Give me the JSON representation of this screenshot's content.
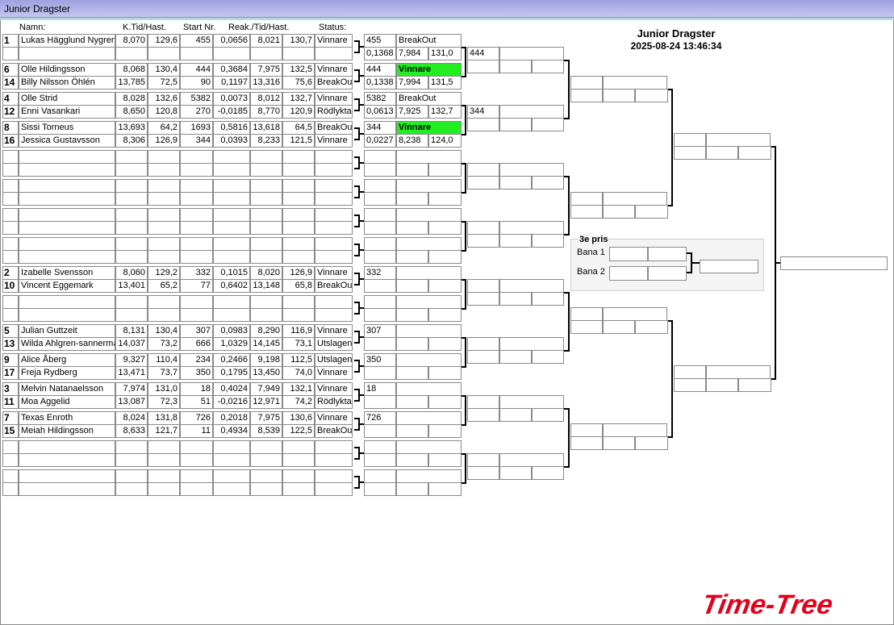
{
  "window": {
    "title": "Junior Dragster"
  },
  "headers": {
    "name": "Namn:",
    "kt": "K.Tid/Hast.",
    "start": "Start Nr.",
    "reak": "Reak./Tid/Hast.",
    "status": "Status:"
  },
  "bracket": {
    "title": "Junior Dragster",
    "datetime": "2025-08-24 13:46:34"
  },
  "third_place": {
    "title": "3e pris",
    "lane1": "Bana 1",
    "lane2": "Bana 2"
  },
  "logo": {
    "text": "Time-Tree",
    "color": "#e2001a"
  },
  "colors": {
    "winner": "#22ee22"
  },
  "racers": [
    {
      "seed": "1",
      "name": "Lukas Hägglund Nygren",
      "kt": "8,070",
      "ks": "129,6",
      "start": "455",
      "reak": "0,0656",
      "tid": "8,021",
      "hast": "130,7",
      "status": "Vinnare"
    },
    {
      "seed": "",
      "name": "",
      "kt": "",
      "ks": "",
      "start": "",
      "reak": "",
      "tid": "",
      "hast": "",
      "status": ""
    },
    {
      "seed": "6",
      "name": "Olle Hildingsson",
      "kt": "8,068",
      "ks": "130,4",
      "start": "444",
      "reak": "0,3684",
      "tid": "7,975",
      "hast": "132,5",
      "status": "Vinnare"
    },
    {
      "seed": "14",
      "name": "Billy Nilsson Öhlén",
      "kt": "13,785",
      "ks": "72,5",
      "start": "90",
      "reak": "0,1197",
      "tid": "13,316",
      "hast": "75,6",
      "status": "BreakOut"
    },
    {
      "seed": "4",
      "name": "Olle Strid",
      "kt": "8,028",
      "ks": "132,6",
      "start": "5382",
      "reak": "0,0073",
      "tid": "8,012",
      "hast": "132,7",
      "status": "Vinnare"
    },
    {
      "seed": "12",
      "name": "Enni Vasankari",
      "kt": "8,650",
      "ks": "120,8",
      "start": "270",
      "reak": "-0,0185",
      "tid": "8,770",
      "hast": "120,9",
      "status": "Rödlykta"
    },
    {
      "seed": "8",
      "name": "Sissi Torneus",
      "kt": "13,693",
      "ks": "64,2",
      "start": "1693",
      "reak": "0,5816",
      "tid": "13,618",
      "hast": "64,5",
      "status": "BreakOut"
    },
    {
      "seed": "16",
      "name": "Jessica Gustavsson",
      "kt": "8,306",
      "ks": "126,9",
      "start": "344",
      "reak": "0,0393",
      "tid": "8,233",
      "hast": "121,5",
      "status": "Vinnare"
    },
    {
      "seed": "",
      "name": "",
      "kt": "",
      "ks": "",
      "start": "",
      "reak": "",
      "tid": "",
      "hast": "",
      "status": ""
    },
    {
      "seed": "",
      "name": "",
      "kt": "",
      "ks": "",
      "start": "",
      "reak": "",
      "tid": "",
      "hast": "",
      "status": ""
    },
    {
      "seed": "",
      "name": "",
      "kt": "",
      "ks": "",
      "start": "",
      "reak": "",
      "tid": "",
      "hast": "",
      "status": ""
    },
    {
      "seed": "",
      "name": "",
      "kt": "",
      "ks": "",
      "start": "",
      "reak": "",
      "tid": "",
      "hast": "",
      "status": ""
    },
    {
      "seed": "",
      "name": "",
      "kt": "",
      "ks": "",
      "start": "",
      "reak": "",
      "tid": "",
      "hast": "",
      "status": ""
    },
    {
      "seed": "",
      "name": "",
      "kt": "",
      "ks": "",
      "start": "",
      "reak": "",
      "tid": "",
      "hast": "",
      "status": ""
    },
    {
      "seed": "",
      "name": "",
      "kt": "",
      "ks": "",
      "start": "",
      "reak": "",
      "tid": "",
      "hast": "",
      "status": ""
    },
    {
      "seed": "",
      "name": "",
      "kt": "",
      "ks": "",
      "start": "",
      "reak": "",
      "tid": "",
      "hast": "",
      "status": ""
    },
    {
      "seed": "2",
      "name": "Izabelle Svensson",
      "kt": "8,060",
      "ks": "129,2",
      "start": "332",
      "reak": "0,1015",
      "tid": "8,020",
      "hast": "126,9",
      "status": "Vinnare"
    },
    {
      "seed": "10",
      "name": "Vincent Eggemark",
      "kt": "13,401",
      "ks": "65,2",
      "start": "77",
      "reak": "0,6402",
      "tid": "13,148",
      "hast": "65,8",
      "status": "BreakOut"
    },
    {
      "seed": "",
      "name": "",
      "kt": "",
      "ks": "",
      "start": "",
      "reak": "",
      "tid": "",
      "hast": "",
      "status": ""
    },
    {
      "seed": "",
      "name": "",
      "kt": "",
      "ks": "",
      "start": "",
      "reak": "",
      "tid": "",
      "hast": "",
      "status": ""
    },
    {
      "seed": "5",
      "name": "Julian  Guttzeit",
      "kt": "8,131",
      "ks": "130,4",
      "start": "307",
      "reak": "0,0983",
      "tid": "8,290",
      "hast": "116,9",
      "status": "Vinnare"
    },
    {
      "seed": "13",
      "name": "Wilda Ahlgren-sannerman",
      "kt": "14,037",
      "ks": "73,2",
      "start": "666",
      "reak": "1,0329",
      "tid": "14,145",
      "hast": "73,1",
      "status": "Utslagen"
    },
    {
      "seed": "9",
      "name": "Alice Åberg",
      "kt": "9,327",
      "ks": "110,4",
      "start": "234",
      "reak": "0,2466",
      "tid": "9,198",
      "hast": "112,5",
      "status": "Utslagen"
    },
    {
      "seed": "17",
      "name": "Freja Rydberg",
      "kt": "13,471",
      "ks": "73,7",
      "start": "350",
      "reak": "0,1795",
      "tid": "13,450",
      "hast": "74,0",
      "status": "Vinnare"
    },
    {
      "seed": "3",
      "name": "Melvin Natanaelsson",
      "kt": "7,974",
      "ks": "131,0",
      "start": "18",
      "reak": "0,4024",
      "tid": "7,949",
      "hast": "132,1",
      "status": "Vinnare"
    },
    {
      "seed": "11",
      "name": "Moa Aggelid",
      "kt": "13,087",
      "ks": "72,3",
      "start": "51",
      "reak": "-0,0216",
      "tid": "12,971",
      "hast": "74,2",
      "status": "Rödlykta"
    },
    {
      "seed": "7",
      "name": "Texas Enroth",
      "kt": "8,024",
      "ks": "131,8",
      "start": "726",
      "reak": "0,2018",
      "tid": "7,975",
      "hast": "130,6",
      "status": "Vinnare"
    },
    {
      "seed": "15",
      "name": "Meiah Hildingsson",
      "kt": "8,633",
      "ks": "121,7",
      "start": "11",
      "reak": "0,4934",
      "tid": "8,539",
      "hast": "122,5",
      "status": "BreakOut"
    },
    {
      "seed": "",
      "name": "",
      "kt": "",
      "ks": "",
      "start": "",
      "reak": "",
      "tid": "",
      "hast": "",
      "status": ""
    },
    {
      "seed": "",
      "name": "",
      "kt": "",
      "ks": "",
      "start": "",
      "reak": "",
      "tid": "",
      "hast": "",
      "status": ""
    },
    {
      "seed": "",
      "name": "",
      "kt": "",
      "ks": "",
      "start": "",
      "reak": "",
      "tid": "",
      "hast": "",
      "status": ""
    },
    {
      "seed": "",
      "name": "",
      "kt": "",
      "ks": "",
      "start": "",
      "reak": "",
      "tid": "",
      "hast": "",
      "status": ""
    }
  ],
  "round1": [
    {
      "top": {
        "a": "455",
        "b": "BreakOut"
      },
      "bot": {
        "a": "0,1368",
        "b": "7,984",
        "c": "131,0"
      },
      "winner": false
    },
    {
      "top": {
        "a": "444",
        "b": "Vinnare"
      },
      "bot": {
        "a": "0,1338",
        "b": "7,994",
        "c": "131,5"
      },
      "winner": true
    },
    {
      "top": {
        "a": "5382",
        "b": "BreakOut"
      },
      "bot": {
        "a": "0,0613",
        "b": "7,925",
        "c": "132,7"
      },
      "winner": false
    },
    {
      "top": {
        "a": "344",
        "b": "Vinnare"
      },
      "bot": {
        "a": "0,0227",
        "b": "8,238",
        "c": "124,0"
      },
      "winner": true
    },
    {
      "top": {
        "a": "",
        "b": ""
      },
      "bot": {
        "a": "",
        "b": "",
        "c": ""
      },
      "winner": false
    },
    {
      "top": {
        "a": "",
        "b": ""
      },
      "bot": {
        "a": "",
        "b": "",
        "c": ""
      },
      "winner": false
    },
    {
      "top": {
        "a": "",
        "b": ""
      },
      "bot": {
        "a": "",
        "b": "",
        "c": ""
      },
      "winner": false
    },
    {
      "top": {
        "a": "",
        "b": ""
      },
      "bot": {
        "a": "",
        "b": "",
        "c": ""
      },
      "winner": false
    },
    {
      "top": {
        "a": "332",
        "b": ""
      },
      "bot": {
        "a": "",
        "b": "",
        "c": ""
      },
      "winner": false
    },
    {
      "top": {
        "a": "",
        "b": ""
      },
      "bot": {
        "a": "",
        "b": "",
        "c": ""
      },
      "winner": false
    },
    {
      "top": {
        "a": "307",
        "b": ""
      },
      "bot": {
        "a": "",
        "b": "",
        "c": ""
      },
      "winner": false
    },
    {
      "top": {
        "a": "350",
        "b": ""
      },
      "bot": {
        "a": "",
        "b": "",
        "c": ""
      },
      "winner": false
    },
    {
      "top": {
        "a": "18",
        "b": ""
      },
      "bot": {
        "a": "",
        "b": "",
        "c": ""
      },
      "winner": false
    },
    {
      "top": {
        "a": "726",
        "b": ""
      },
      "bot": {
        "a": "",
        "b": "",
        "c": ""
      },
      "winner": false
    },
    {
      "top": {
        "a": "",
        "b": ""
      },
      "bot": {
        "a": "",
        "b": "",
        "c": ""
      },
      "winner": false
    },
    {
      "top": {
        "a": "",
        "b": ""
      },
      "bot": {
        "a": "",
        "b": "",
        "c": ""
      },
      "winner": false
    }
  ],
  "round2": [
    {
      "top": "444"
    },
    {
      "top": "344"
    },
    {
      "top": ""
    },
    {
      "top": ""
    },
    {
      "top": ""
    },
    {
      "top": ""
    },
    {
      "top": ""
    },
    {
      "top": ""
    }
  ]
}
